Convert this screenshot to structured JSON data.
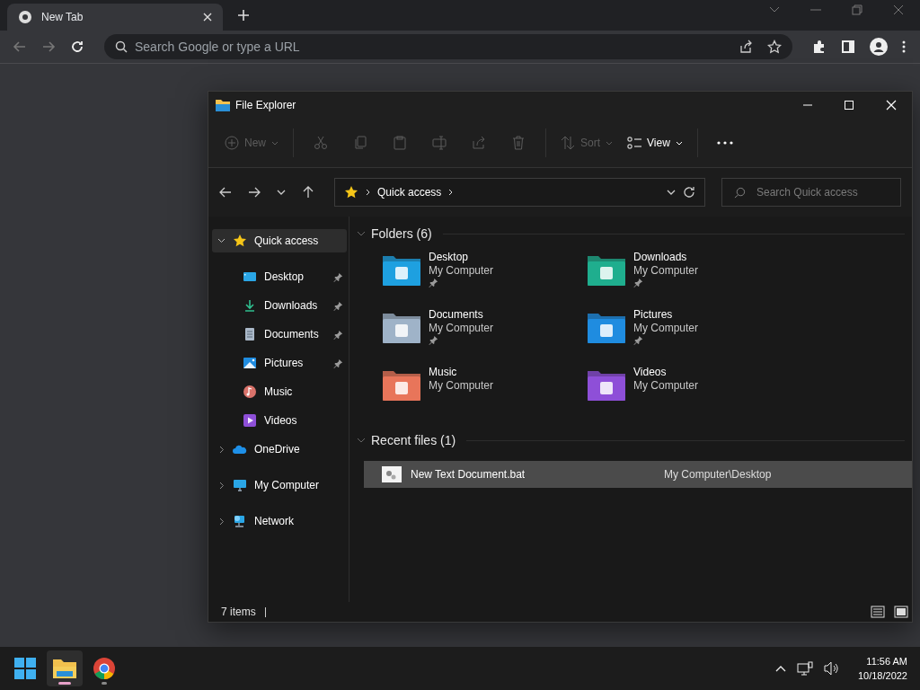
{
  "browser": {
    "tab": {
      "title": "New Tab",
      "selected": true
    },
    "omnibox": {
      "placeholder": "Search Google or type a URL"
    }
  },
  "explorer": {
    "title": "File Explorer",
    "toolbar": [
      {
        "kind": "new",
        "label": "New",
        "disabled": true
      },
      {
        "kind": "cut",
        "disabled": true
      },
      {
        "kind": "copy",
        "disabled": true
      },
      {
        "kind": "paste",
        "disabled": true
      },
      {
        "kind": "rename",
        "disabled": true
      },
      {
        "kind": "share",
        "disabled": true
      },
      {
        "kind": "delete",
        "disabled": true
      },
      {
        "kind": "sort",
        "label": "Sort",
        "disabled": true
      },
      {
        "kind": "view",
        "label": "View",
        "disabled": false
      },
      {
        "kind": "more",
        "disabled": false
      }
    ],
    "address": {
      "path": [
        "Quick access"
      ],
      "search_placeholder": "Search Quick access"
    },
    "sidebar": [
      {
        "kind": "star",
        "label": "Quick access",
        "expanded": true,
        "selected": true,
        "children": [
          {
            "kind": "desktop",
            "label": "Desktop",
            "pinned": true,
            "selected": false
          },
          {
            "kind": "downloads",
            "label": "Downloads",
            "pinned": true,
            "selected": false
          },
          {
            "kind": "documents",
            "label": "Documents",
            "pinned": true,
            "selected": false
          },
          {
            "kind": "pictures",
            "label": "Pictures",
            "pinned": true,
            "selected": false
          },
          {
            "kind": "music",
            "label": "Music",
            "pinned": false,
            "selected": false
          },
          {
            "kind": "videos",
            "label": "Videos",
            "pinned": false,
            "selected": false
          }
        ]
      },
      {
        "kind": "cloud",
        "label": "OneDrive",
        "expanded": false,
        "selected": false
      },
      {
        "kind": "computer",
        "label": "My Computer",
        "expanded": false,
        "selected": false
      },
      {
        "kind": "network",
        "label": "Network",
        "expanded": false,
        "selected": false
      }
    ],
    "folders": {
      "title": "Folders (6)",
      "expanded": true,
      "items": [
        {
          "kind": "desktop",
          "name": "Desktop",
          "location": "My Computer",
          "pinned": true
        },
        {
          "kind": "downloads",
          "name": "Downloads",
          "location": "My Computer",
          "pinned": true
        },
        {
          "kind": "documents",
          "name": "Documents",
          "location": "My Computer",
          "pinned": true
        },
        {
          "kind": "pictures",
          "name": "Pictures",
          "location": "My Computer",
          "pinned": true
        },
        {
          "kind": "music",
          "name": "Music",
          "location": "My Computer",
          "pinned": false
        },
        {
          "kind": "videos",
          "name": "Videos",
          "location": "My Computer",
          "pinned": false
        }
      ]
    },
    "recent": {
      "title": "Recent files (1)",
      "expanded": true,
      "rows": [
        {
          "name": "New Text Document.bat",
          "path": "My Computer\\Desktop",
          "selected": true
        }
      ]
    },
    "status_bar": {
      "count": "7 items"
    }
  },
  "taskbar": {
    "apps": [
      {
        "kind": "start",
        "active": false
      },
      {
        "kind": "explorer",
        "active": true
      },
      {
        "kind": "chrome",
        "active": false
      }
    ],
    "time": "11:56 AM",
    "date": "10/18/2022"
  }
}
